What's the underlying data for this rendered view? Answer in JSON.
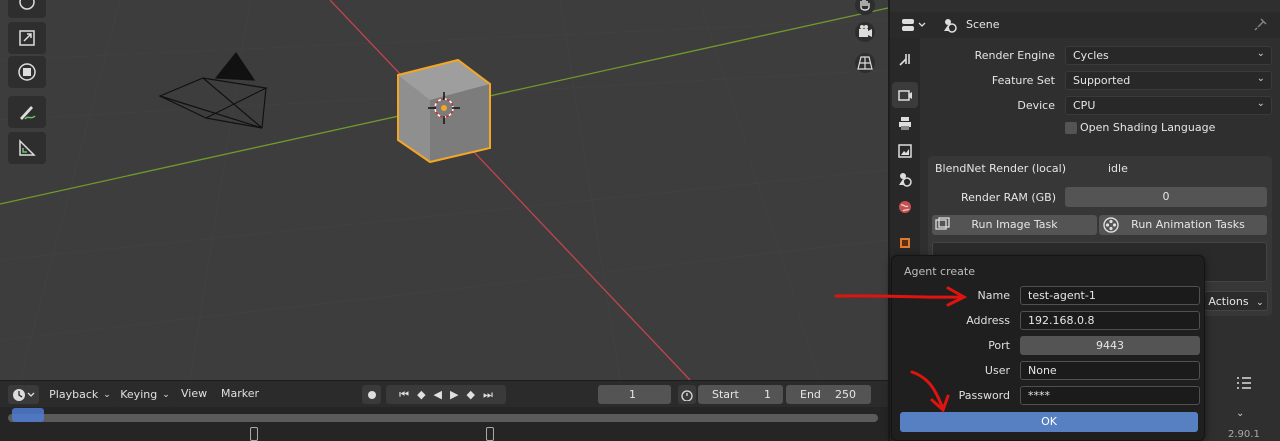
{
  "viewport": {
    "tools": [
      "transform-icon",
      "scale-icon",
      "transform-all-icon",
      "annotate-icon",
      "measure-icon"
    ],
    "nav_icons": [
      "hand-icon",
      "camera-view-icon",
      "perspective-grid-icon"
    ]
  },
  "timeline": {
    "playback": "Playback",
    "keying": "Keying",
    "view": "View",
    "marker": "Marker",
    "current_frame": "1",
    "start_label": "Start",
    "start_value": "1",
    "end_label": "End",
    "end_value": "250"
  },
  "props": {
    "header_title": "Scene",
    "render_engine_label": "Render Engine",
    "render_engine_value": "Cycles",
    "feature_set_label": "Feature Set",
    "feature_set_value": "Supported",
    "device_label": "Device",
    "device_value": "CPU",
    "osl_label": "Open Shading Language",
    "blendnet_title": "BlendNet Render (local)",
    "blendnet_status": "idle",
    "render_ram_label": "Render RAM (GB)",
    "render_ram_value": "0",
    "run_image_label": "Run Image Task",
    "run_anim_label": "Run Animation Tasks",
    "actions_label": "Actions",
    "version": "2.90.1"
  },
  "dialog": {
    "title": "Agent create",
    "name_label": "Name",
    "name_value": "test-agent-1",
    "address_label": "Address",
    "address_value": "192.168.0.8",
    "port_label": "Port",
    "port_value": "9443",
    "user_label": "User",
    "user_value": "None",
    "password_label": "Password",
    "password_value": "****",
    "ok_label": "OK"
  },
  "colors": {
    "selection_outline": "#f5a623",
    "x_axis": "#c0444e",
    "y_axis": "#6f9a2c",
    "ok_button": "#5680c2",
    "annotation_arrow": "#e0140f"
  }
}
